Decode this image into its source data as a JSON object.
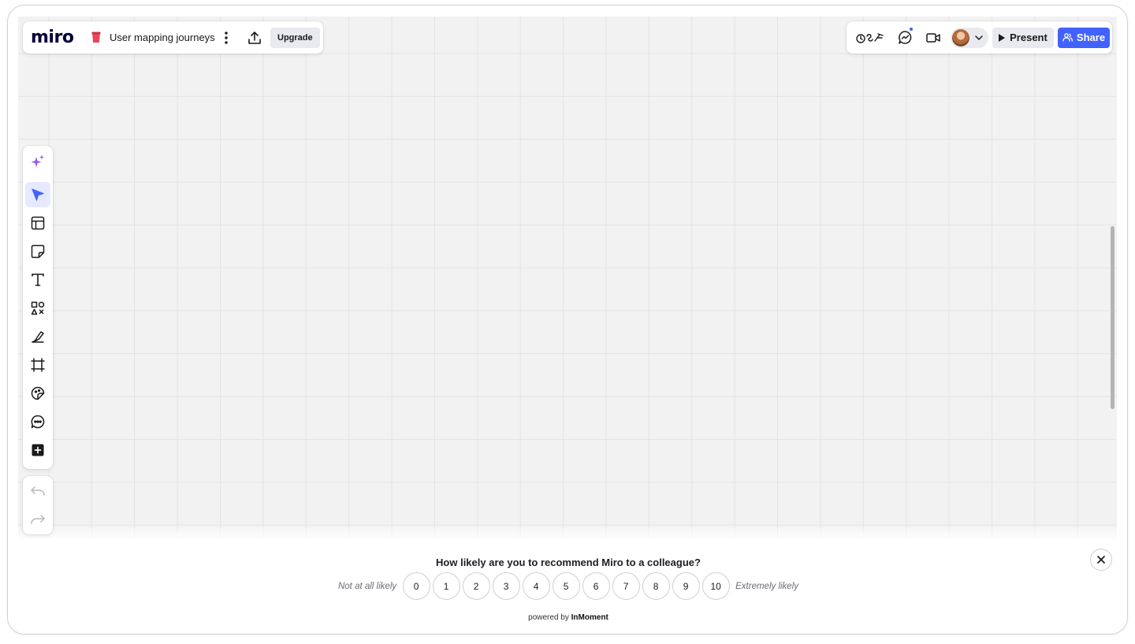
{
  "header": {
    "logo": "miro",
    "board_title": "User mapping journeys",
    "upgrade_label": "Upgrade",
    "present_label": "Present",
    "share_label": "Share"
  },
  "colors": {
    "accent": "#4262ff",
    "ai_purple": "#9b5cf6",
    "board_icon": "#e8475f",
    "canvas": "#f2f2f2"
  },
  "toolbar": {
    "tools": [
      {
        "name": "ai-sparkle-icon"
      },
      {
        "name": "select-cursor-icon",
        "active": true
      },
      {
        "name": "templates-icon"
      },
      {
        "name": "sticky-note-icon"
      },
      {
        "name": "text-icon"
      },
      {
        "name": "shapes-icon"
      },
      {
        "name": "pen-icon"
      },
      {
        "name": "frame-icon"
      },
      {
        "name": "sticker-icon"
      },
      {
        "name": "comment-icon"
      },
      {
        "name": "more-apps-icon"
      }
    ],
    "history": [
      "undo-icon",
      "redo-icon"
    ]
  },
  "survey": {
    "question": "How likely are you to recommend Miro to a colleague?",
    "low_label": "Not at all likely",
    "high_label": "Extremely likely",
    "options": [
      "0",
      "1",
      "2",
      "3",
      "4",
      "5",
      "6",
      "7",
      "8",
      "9",
      "10"
    ],
    "powered_prefix": "powered by",
    "powered_brand": "InMoment"
  }
}
